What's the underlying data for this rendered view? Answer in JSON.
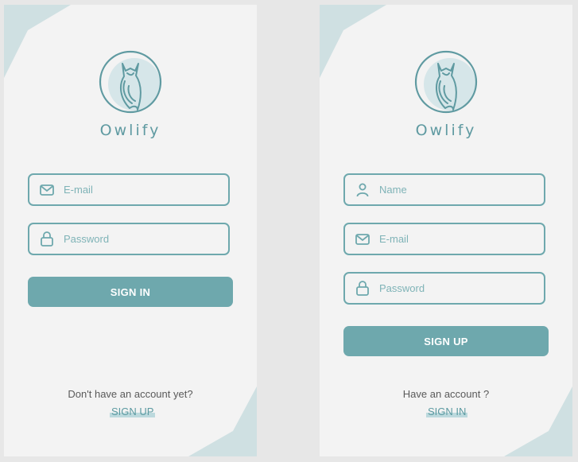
{
  "brand_color": "#6ea8ad",
  "signin_screen": {
    "brand": "Owlify",
    "email": {
      "placeholder": "E-mail",
      "icon": "mail-icon"
    },
    "password": {
      "placeholder": "Password",
      "icon": "lock-icon"
    },
    "submit_label": "SIGN IN",
    "prompt": "Don't have an account yet?",
    "switch_label": "SIGN UP"
  },
  "signup_screen": {
    "brand": "Owlify",
    "name": {
      "placeholder": "Name",
      "icon": "user-icon"
    },
    "email": {
      "placeholder": "E-mail",
      "icon": "mail-icon"
    },
    "password": {
      "placeholder": "Password",
      "icon": "lock-icon"
    },
    "submit_label": "SIGN UP",
    "prompt": "Have an account ?",
    "switch_label": "SIGN IN"
  }
}
